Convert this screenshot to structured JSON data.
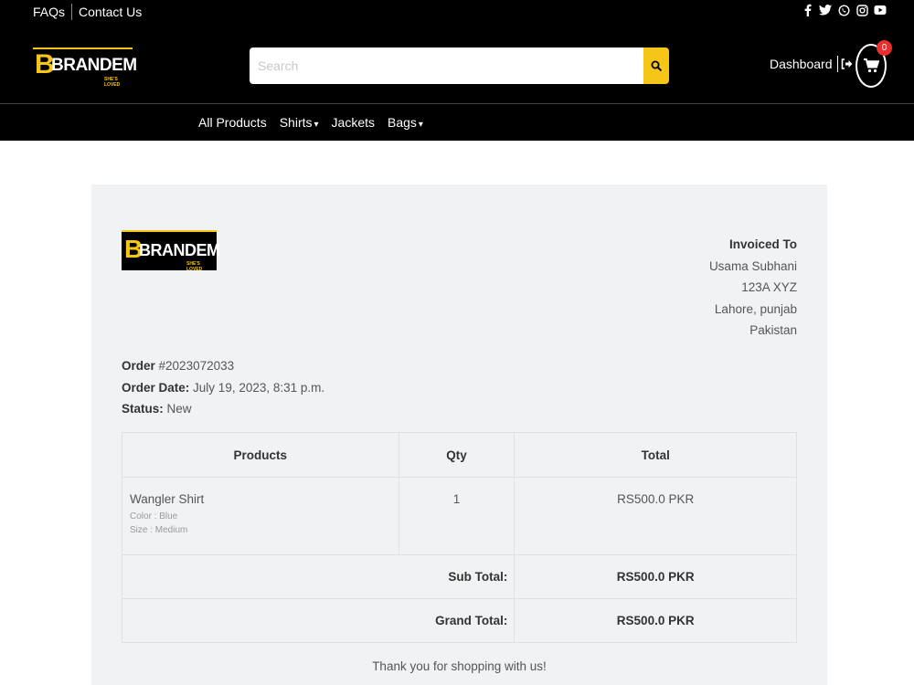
{
  "header": {
    "top_links": [
      "FAQs",
      "Contact Us"
    ],
    "social_icons": [
      "facebook-icon",
      "twitter-icon",
      "whatsapp-icon",
      "instagram-icon",
      "youtube-icon"
    ],
    "brand": {
      "initial": "B",
      "word": "BRANDEM",
      "tagline": "SHE'S LOVED"
    },
    "search": {
      "placeholder": "Search",
      "value": ""
    },
    "dashboard_label": "Dashboard",
    "cart_count": "0",
    "accent_color": "#f5c518"
  },
  "nav": {
    "items": [
      {
        "label": "All Products",
        "dropdown": false
      },
      {
        "label": "Shirts",
        "dropdown": true
      },
      {
        "label": "Jackets",
        "dropdown": false
      },
      {
        "label": "Bags",
        "dropdown": true
      }
    ]
  },
  "invoice": {
    "invoiced_to_title": "Invoiced To",
    "customer_name": "Usama Subhani",
    "address_line": "123A XYZ",
    "city": "Lahore, punjab",
    "country": "Pakistan",
    "order_label": "Order",
    "order_number": "#2023072033",
    "order_date_label": "Order Date:",
    "order_date": "July 19, 2023, 8:31 p.m.",
    "status_label": "Status:",
    "status": "New",
    "columns": [
      "Products",
      "Qty",
      "Total"
    ],
    "items": [
      {
        "name": "Wangler Shirt",
        "color": "Color : Blue",
        "size": "Size : Medium",
        "qty": "1",
        "total": "RS500.0 PKR"
      }
    ],
    "sub_total_label": "Sub Total:",
    "sub_total": "RS500.0 PKR",
    "grand_total_label": "Grand Total:",
    "grand_total": "RS500.0 PKR",
    "thanks": "Thank you for shopping with us!"
  }
}
